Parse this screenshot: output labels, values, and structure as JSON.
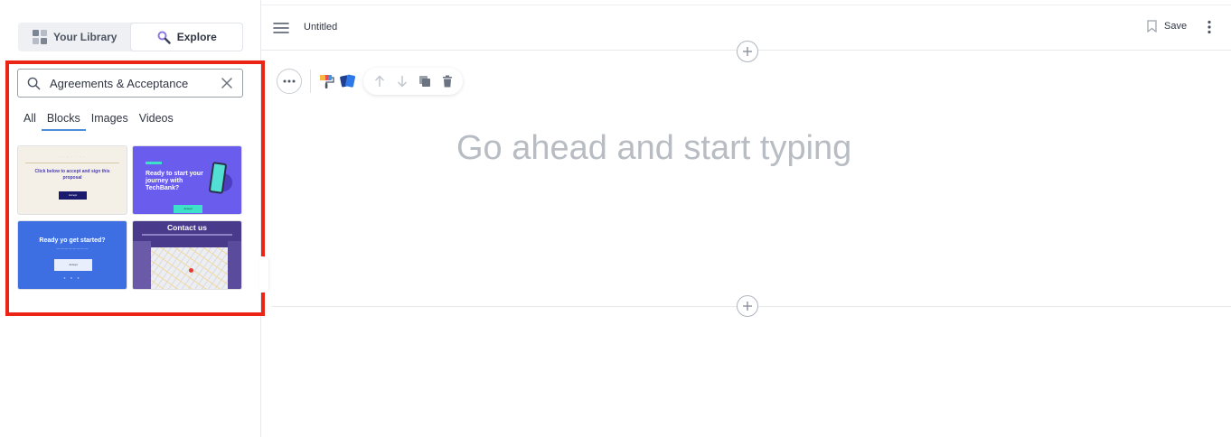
{
  "sidebar": {
    "tabs": [
      {
        "label": "Your Library",
        "icon": "library-grid-icon"
      },
      {
        "label": "Explore",
        "icon": "explore-magnifier-icon"
      }
    ],
    "search": {
      "value": "Agreements & Acceptance",
      "placeholder": "Search"
    },
    "filters": [
      "All",
      "Blocks",
      "Images",
      "Videos"
    ],
    "active_filter": "Blocks",
    "thumbnails": [
      {
        "text": "Click below to accept and sign this proposal",
        "button": "Accept"
      },
      {
        "text": "Ready to start your journey with TechBank?",
        "button": "Accept"
      },
      {
        "title": "Ready yo get started?",
        "button": "Accept"
      },
      {
        "title": "Contact us"
      }
    ]
  },
  "header": {
    "title": "Untitled",
    "save_label": "Save"
  },
  "editor": {
    "placeholder": "Go ahead and start typing"
  },
  "colors": {
    "highlight": "#ec2415",
    "accent": "#4a90d9",
    "placeholder_text": "#b8bcc3"
  }
}
